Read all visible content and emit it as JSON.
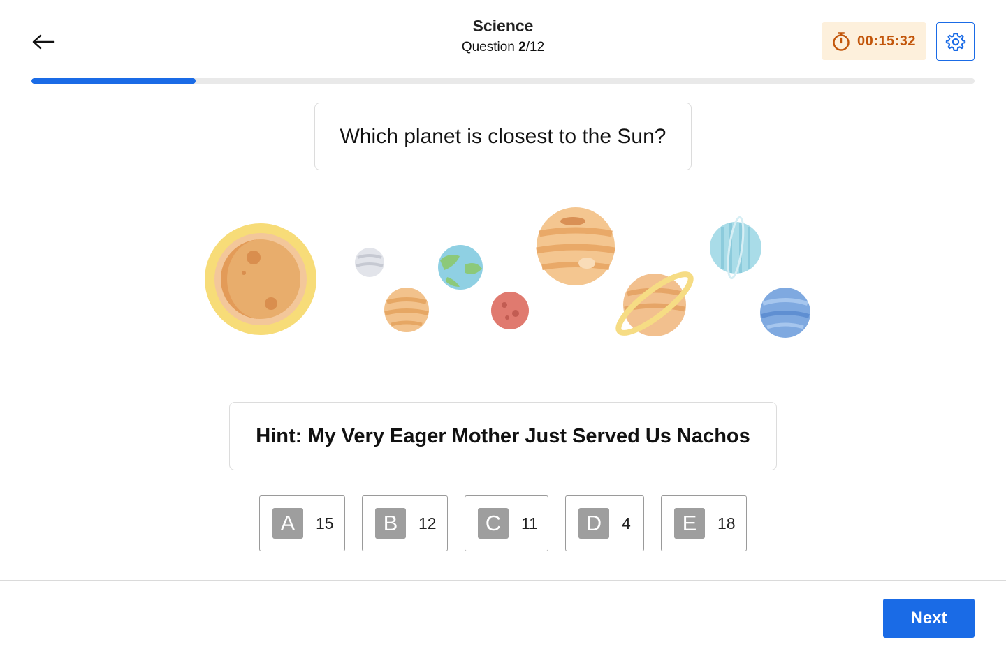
{
  "header": {
    "subject": "Science",
    "question_label": "Question ",
    "question_current": "2",
    "question_total": "/12",
    "timer": "00:15:32"
  },
  "progress": {
    "fraction": 0.174
  },
  "question": {
    "text": "Which planet is closest to the Sun?"
  },
  "hint": {
    "text": "Hint: My Very Eager Mother Just Served Us Nachos"
  },
  "options": [
    {
      "letter": "A",
      "value": "15"
    },
    {
      "letter": "B",
      "value": "12"
    },
    {
      "letter": "C",
      "value": "11"
    },
    {
      "letter": "D",
      "value": "4"
    },
    {
      "letter": "E",
      "value": "18"
    }
  ],
  "footer": {
    "next_label": "Next"
  },
  "icons": {
    "back": "arrow-left-icon",
    "timer": "stopwatch-icon",
    "settings": "gear-icon"
  },
  "colors": {
    "accent": "#1a6be6",
    "timer_text": "#c2560b",
    "timer_bg": "#fdf0dc",
    "option_letter_bg": "#9e9e9e"
  }
}
